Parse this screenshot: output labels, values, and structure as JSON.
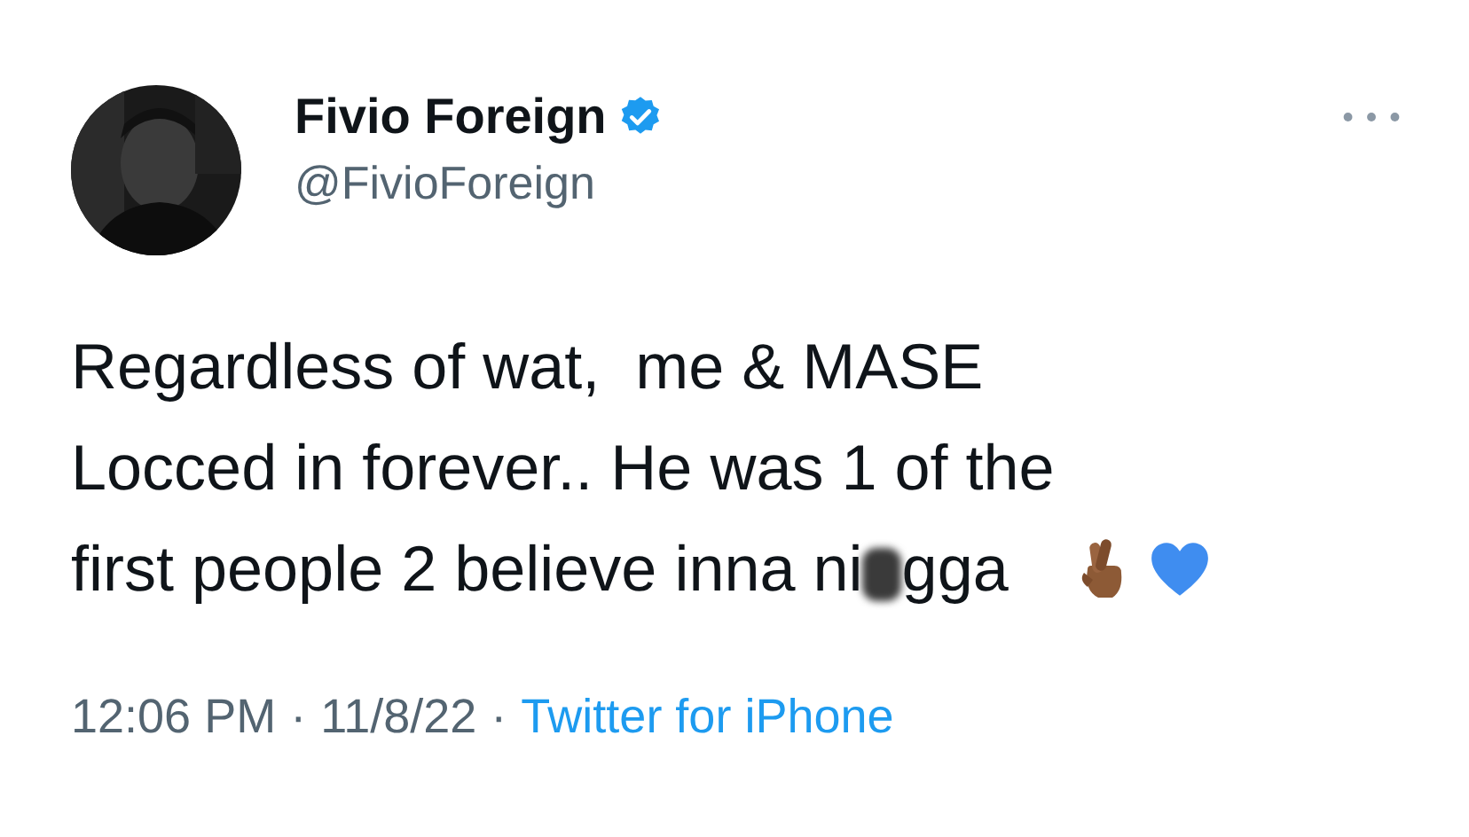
{
  "author": {
    "name": "Fivio Foreign",
    "verified": true,
    "handle": "@FivioForeign"
  },
  "tweet": {
    "lines": [
      "Regardless of wat,  me & MASE",
      "Locced in forever.. He was 1 of the",
      "first people 2 believe inna ni"
    ],
    "after_censor": "gga"
  },
  "footer": {
    "time": "12:06 PM",
    "separator_1": "·",
    "date": "11/8/22",
    "separator_2": "·",
    "source": "Twitter for iPhone"
  }
}
